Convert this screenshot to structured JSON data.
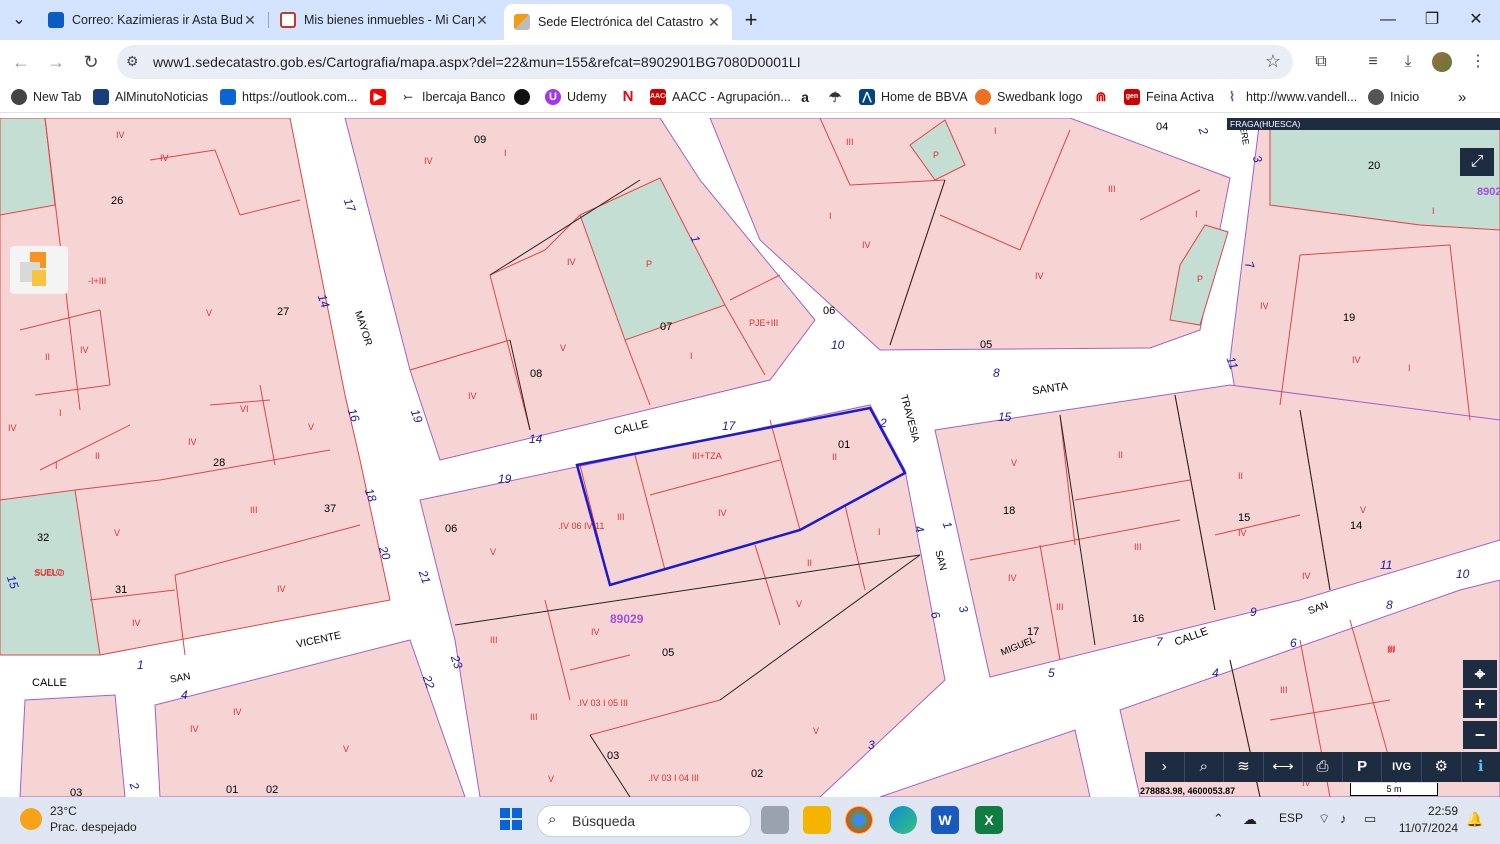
{
  "tabs": [
    {
      "title": "Correo: Kazimieras ir Asta Budr",
      "color": "#0a5bc4"
    },
    {
      "title": "Mis bienes inmuebles - Mi Carp",
      "color": "#c0392b"
    },
    {
      "title": "Sede Electrónica del Catastro -",
      "color": "#e6a100"
    }
  ],
  "window": {
    "minimize": "—",
    "restore": "❐",
    "close": "✕",
    "new_tab": "+",
    "tab_search": "⌄"
  },
  "omnibox": {
    "url": "www1.sedecatastro.gob.es/Cartografia/mapa.aspx?del=22&mun=155&refcat=8902901BG7080D0001LI"
  },
  "bookmarks": [
    {
      "label": "New Tab",
      "color": "#444"
    },
    {
      "label": "AlMinutoNoticias",
      "color": "#1a3d7c"
    },
    {
      "label": "https://outlook.com...",
      "color": "#0a64d8"
    },
    {
      "label": "",
      "color": "#ff0000"
    },
    {
      "label": "Ibercaja Banco",
      "color": "#333"
    },
    {
      "label": "",
      "color": "#111"
    },
    {
      "label": "Udemy",
      "color": "#a435f0"
    },
    {
      "label": "",
      "color": "#e50914"
    },
    {
      "label": "AACC - Agrupación...",
      "color": "#c00"
    },
    {
      "label": "",
      "color": "#222"
    },
    {
      "label": "",
      "color": "#333"
    },
    {
      "label": "Home de BBVA",
      "color": "#004481"
    },
    {
      "label": "Swedbank logo",
      "color": "#ee7023"
    },
    {
      "label": "",
      "color": "#d00"
    },
    {
      "label": "Feina Activa",
      "color": "#c00"
    },
    {
      "label": "http://www.vandell...",
      "color": "#7a4bc9"
    },
    {
      "label": "Inicio",
      "color": "#555"
    }
  ],
  "map": {
    "area_name": "FRAGA(HUESCA)",
    "streets": [
      "CALLE",
      "MAYOR",
      "SANTA",
      "TRAVESIA",
      "SAN",
      "VICENTE",
      "CALLE",
      "SAN",
      "CALLE",
      "SAN",
      "MIGUEL",
      "TERE"
    ],
    "block_ids": [
      "89029",
      "89029"
    ],
    "parcels": [
      "09",
      "04",
      "20",
      "26",
      "27",
      "07",
      "06",
      "05",
      "19",
      "08",
      "01",
      "28",
      "37",
      "32",
      "31",
      "06",
      "18",
      "15",
      "14",
      "05",
      "17",
      "16",
      "03",
      "01",
      "02",
      "03",
      "02",
      "8902"
    ],
    "floors": [
      "IV",
      "III",
      "IV",
      "I",
      "IV",
      "III",
      "I",
      "P",
      "V",
      "P",
      "IV",
      "V",
      "IV",
      "II",
      "IV",
      "I",
      "V",
      "IV",
      "IV",
      "III+TZA",
      "II",
      "III",
      "IV",
      "V",
      "VI",
      "IV",
      "III",
      "IV",
      "II",
      "V",
      "III",
      "IV",
      "I",
      "IV",
      "II",
      "V",
      "III",
      "IV",
      "V",
      "III",
      "IV",
      "II",
      "III",
      "V",
      "IV",
      "II",
      "III",
      "IV",
      "I",
      "IV",
      "II",
      "I",
      "P",
      "PJE+III",
      "-I+III",
      "SUELO",
      "IV",
      ".IV 06 IV 11",
      ".IV 03 I 05 III",
      ".IV 03 I 04 III",
      "III",
      "IV",
      "V",
      "III",
      "I",
      "IV",
      "II",
      "III",
      "V",
      "II",
      "III"
    ],
    "numbers": [
      "17",
      "14",
      "16",
      "18",
      "20",
      "21",
      "22",
      "23",
      "19",
      "14",
      "17",
      "19",
      "1",
      "2",
      "10",
      "8",
      "15",
      "11",
      "7",
      "1",
      "4",
      "3",
      "6",
      "5",
      "7",
      "9",
      "11",
      "10",
      "8",
      "6",
      "4",
      "3",
      "2",
      "1",
      "4",
      "15",
      "2",
      "3"
    ],
    "coords": "278883.98, 4600053.87",
    "scale": "5 m"
  },
  "map_tools": [
    "›",
    "⌕",
    "≋",
    "⟷",
    "⎙",
    "P",
    "IVG",
    "⚙",
    "ℹ"
  ],
  "zoom": {
    "locate": "⌖",
    "plus": "+",
    "minus": "−",
    "fullscreen": "⤢"
  },
  "taskbar": {
    "temperature": "23°C",
    "weather": "Prac. despejado",
    "search_placeholder": "Búsqueda",
    "language": "ESP",
    "time": "22:59",
    "date": "11/07/2024"
  }
}
